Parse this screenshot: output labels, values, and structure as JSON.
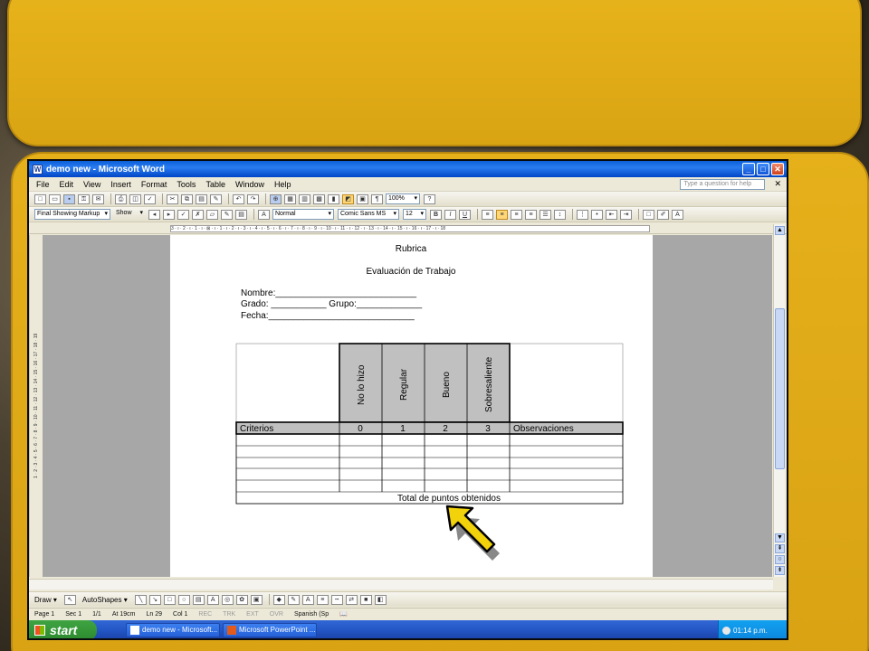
{
  "window": {
    "title": "demo new - Microsoft Word",
    "min": "_",
    "max": "□",
    "close": "✕"
  },
  "menu": {
    "items": [
      "File",
      "Edit",
      "View",
      "Insert",
      "Format",
      "Tools",
      "Table",
      "Window",
      "Help"
    ],
    "help_placeholder": "Type a question for help",
    "close": "✕"
  },
  "toolbar": {
    "zoom": "100%",
    "markup": "Final Showing Markup",
    "show": "Show",
    "style": "Normal",
    "font": "Comic Sans MS",
    "size": "12",
    "bold": "B",
    "italic": "I",
    "underline": "U"
  },
  "ruler": {
    "marks": "3 · ı · 2 · ı · 1 · ı · ⊠ · ı · 1 · ı · 2 · ı · 3 · ı · 4 · ı · 5 · ı · 6 · ı · 7 · ı · 8 · ı · 9 · ı · 10 · ı · 11 · ı · 12 · ı · 13 · ı · 14 · ı · 15 · ı · 16 · ı · 17 · ı · 18",
    "vmarks": "1 · 2 · 3 · 4 · 5 · 6 · 7 · 8 · 9 · 10 · 11 · 12 · 13 · 14 · 15 · 16 · 17 · 18 · 19"
  },
  "document": {
    "title": "Rubrica",
    "subtitle": "Evaluación de Trabajo",
    "nombre": "Nombre:____________________________",
    "grado": "Grado: ___________  Grupo:_____________",
    "fecha": "Fecha:_____________________________",
    "levels": [
      "No lo hizo",
      "Regular",
      "Bueno",
      "Sobresaliente"
    ],
    "criterios": "Criterios",
    "scores": [
      "0",
      "1",
      "2",
      "3"
    ],
    "observaciones": "Observaciones",
    "total": "Total de puntos obtenidos"
  },
  "drawbar": {
    "draw": "Draw ▾",
    "autoshapes": "AutoShapes ▾"
  },
  "status": {
    "page": "Page 1",
    "sec": "Sec 1",
    "pages": "1/1",
    "at": "At 19cm",
    "ln": "Ln 29",
    "col": "Col 1",
    "rec": "REC",
    "trk": "TRK",
    "ext": "EXT",
    "ovr": "OVR",
    "lang": "Spanish (Sp"
  },
  "taskbar": {
    "start": "start",
    "tasks": [
      "demo new - Microsoft...",
      "Microsoft PowerPoint ..."
    ],
    "clock": "01:14 p.m."
  },
  "colors": {
    "slide": "#e0aa18",
    "titlebar": "#0a5fd8",
    "arrow": "#f2d20a",
    "header_fill": "#c0c0c0"
  }
}
